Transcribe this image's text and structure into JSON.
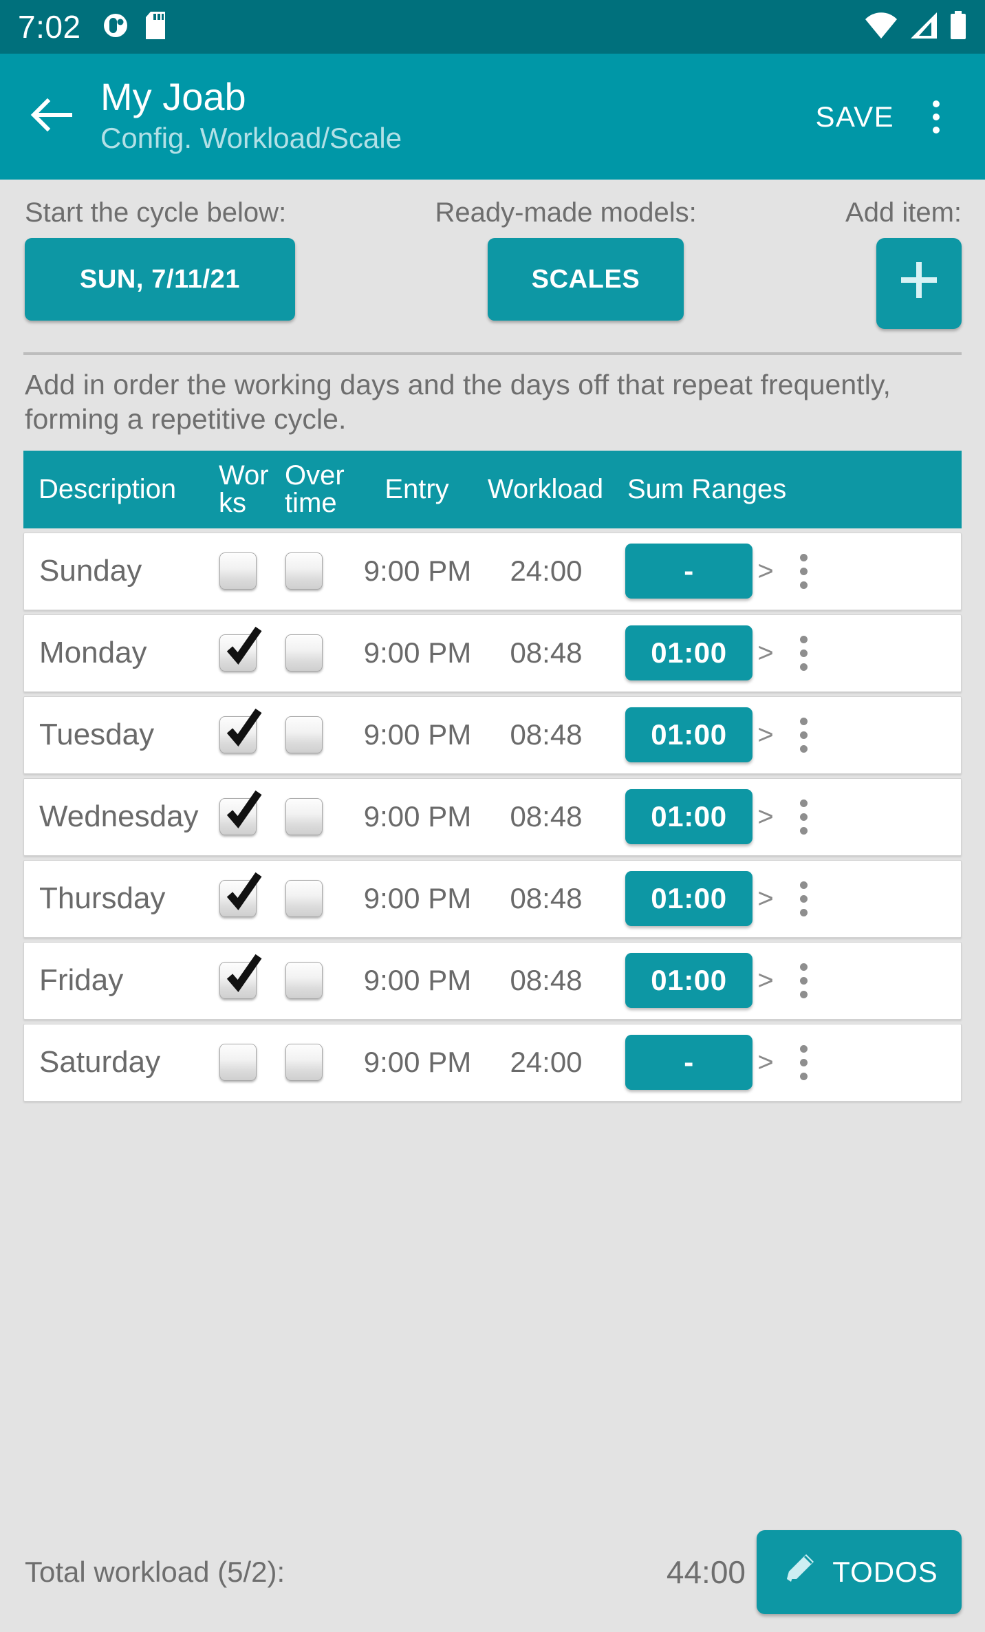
{
  "statusbar": {
    "time": "7:02",
    "icons": [
      "app-circle-icon",
      "sd-card-icon",
      "wifi-icon",
      "cellular-signal-icon",
      "battery-icon"
    ]
  },
  "appbar": {
    "back_icon": "back-arrow-icon",
    "title": "My Joab",
    "subtitle": "Config. Workload/Scale",
    "save_label": "SAVE",
    "overflow_icon": "more-vertical-icon"
  },
  "controls": {
    "label_cycle": "Start the cycle below:",
    "label_models": "Ready-made models:",
    "label_add": "Add item:",
    "btn_date": "SUN, 7/11/21",
    "btn_scales": "SCALES",
    "btn_add_icon": "plus-icon"
  },
  "hint": "Add in order the working days and the days off that repeat frequently, forming a repetitive cycle.",
  "table": {
    "headers": {
      "description": "Description",
      "works": "Wor ks",
      "overtime": "Over time",
      "entry": "Entry",
      "workload": "Workload",
      "sum_ranges": "Sum Ranges"
    },
    "rows": [
      {
        "description": "Sunday",
        "works": false,
        "overtime": false,
        "entry": "9:00 PM",
        "workload": "24:00",
        "sum_ranges": "-"
      },
      {
        "description": "Monday",
        "works": true,
        "overtime": false,
        "entry": "9:00 PM",
        "workload": "08:48",
        "sum_ranges": "01:00"
      },
      {
        "description": "Tuesday",
        "works": true,
        "overtime": false,
        "entry": "9:00 PM",
        "workload": "08:48",
        "sum_ranges": "01:00"
      },
      {
        "description": "Wednesday",
        "works": true,
        "overtime": false,
        "entry": "9:00 PM",
        "workload": "08:48",
        "sum_ranges": "01:00"
      },
      {
        "description": "Thursday",
        "works": true,
        "overtime": false,
        "entry": "9:00 PM",
        "workload": "08:48",
        "sum_ranges": "01:00"
      },
      {
        "description": "Friday",
        "works": true,
        "overtime": false,
        "entry": "9:00 PM",
        "workload": "08:48",
        "sum_ranges": "01:00"
      },
      {
        "description": "Saturday",
        "works": false,
        "overtime": false,
        "entry": "9:00 PM",
        "workload": "24:00",
        "sum_ranges": "-"
      }
    ],
    "row_chevron": ">",
    "row_menu_icon": "more-vertical-icon"
  },
  "footer": {
    "total_label": "Total workload (5/2):",
    "total_value": "44:00",
    "todos_label": "TODOS",
    "todos_icon": "pencil-icon"
  },
  "colors": {
    "statusbar_teal": "#00707c",
    "appbar_teal": "#0097a7",
    "accent_teal": "#0d97a4",
    "page_bg": "#e3e3e3",
    "text_gray": "#6e6e6e",
    "subtitle_cyan": "#b2e0e6"
  }
}
